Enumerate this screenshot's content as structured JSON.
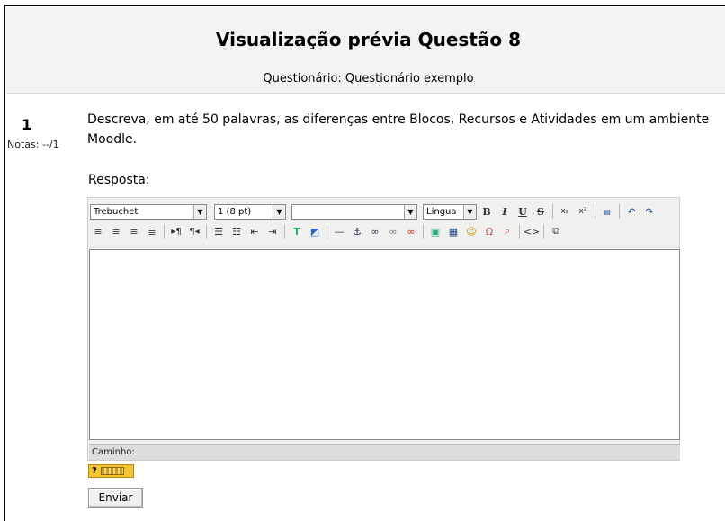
{
  "header": {
    "title": "Visualização prévia Questão 8",
    "subtitle": "Questionário: Questionário exemplo"
  },
  "question": {
    "number": "1",
    "marks": "Notas: --/1",
    "text": "Descreva, em até 50 palavras, as diferenças entre Blocos, Recursos e Atividades em um ambiente Moodle.",
    "answer_label": "Resposta:"
  },
  "editor": {
    "font_family": "Trebuchet",
    "font_size": "1 (8 pt)",
    "style": "",
    "language": "Língua",
    "path_label": "Caminho:"
  },
  "buttons": {
    "help": "?",
    "submit": "Enviar"
  },
  "icons": [
    "bold-icon",
    "italic-icon",
    "underline-icon",
    "strikethrough-icon",
    "subscript-icon",
    "superscript-icon",
    "paste-word-icon",
    "undo-icon",
    "redo-icon",
    "align-left-icon",
    "align-center-icon",
    "align-right-icon",
    "align-justify-icon",
    "ltr-icon",
    "rtl-icon",
    "ordered-list-icon",
    "unordered-list-icon",
    "outdent-icon",
    "indent-icon",
    "text-color-icon",
    "background-color-icon",
    "horizontal-rule-icon",
    "anchor-icon",
    "link-icon",
    "unlink-icon",
    "nolink-icon",
    "image-icon",
    "table-icon",
    "smiley-icon",
    "special-char-icon",
    "search-replace-icon",
    "html-source-icon",
    "fullscreen-icon"
  ]
}
